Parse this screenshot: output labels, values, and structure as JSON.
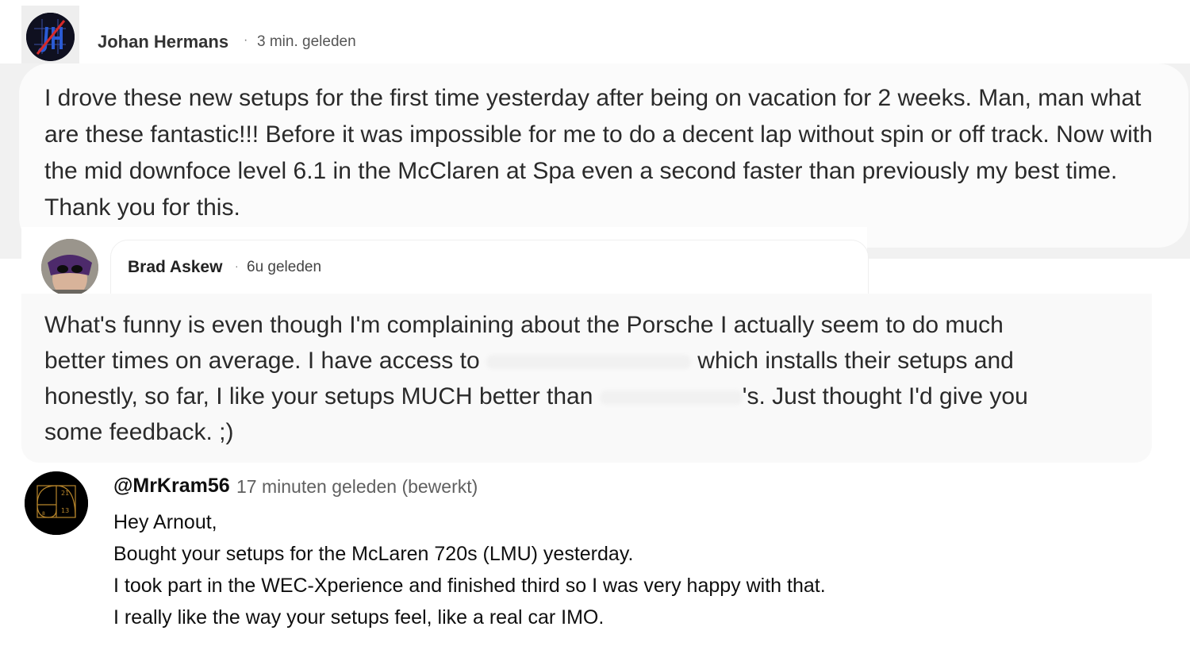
{
  "comments": [
    {
      "author": "Johan Hermans",
      "time": "3 min. geleden",
      "avatar_icon": "jh-monogram-avatar",
      "body": "I drove these new setups for the first time yesterday after being on vacation for 2 weeks. Man, man what are these fantastic!!! Before it was impossible for me to do a decent lap without spin or off track. Now with the mid downfoce level 6.1 in the McClaren at Spa even a second faster than previously my best time. Thank you for this."
    },
    {
      "author": "Brad Askew",
      "time": "6u geleden",
      "avatar_icon": "masked-face-avatar",
      "body_parts": {
        "line1": "What's funny is even though I'm complaining about the Porsche I actually seem to do much",
        "line2a": "better times on average. I have access to ",
        "line2b": " which installs their setups and",
        "line3a": "honestly, so far, I like your setups MUCH better than ",
        "line3b": "'s. Just thought I'd give you",
        "line4": "some feedback. ;)"
      }
    },
    {
      "author": "@MrKram56",
      "time": "17 minuten geleden (bewerkt)",
      "avatar_icon": "golden-spiral-avatar",
      "avatar_numbers": [
        "21",
        "13",
        "8"
      ],
      "lines": [
        "Hey Arnout,",
        "Bought your setups for the McLaren 720s (LMU) yesterday.",
        "I took part in the WEC-Xperience and finished third so I was very happy with that.",
        "I really like the way your setups feel, like a real car IMO."
      ]
    }
  ],
  "colors": {
    "band_gray": "#f1f1f1",
    "bubble_light": "#fbfbfb",
    "text": "#2a2a2a",
    "muted": "#606060",
    "avatar_accent_red": "#d42a2a",
    "avatar_accent_blue": "#2a5bd4",
    "spiral_gold": "#b8862b"
  }
}
